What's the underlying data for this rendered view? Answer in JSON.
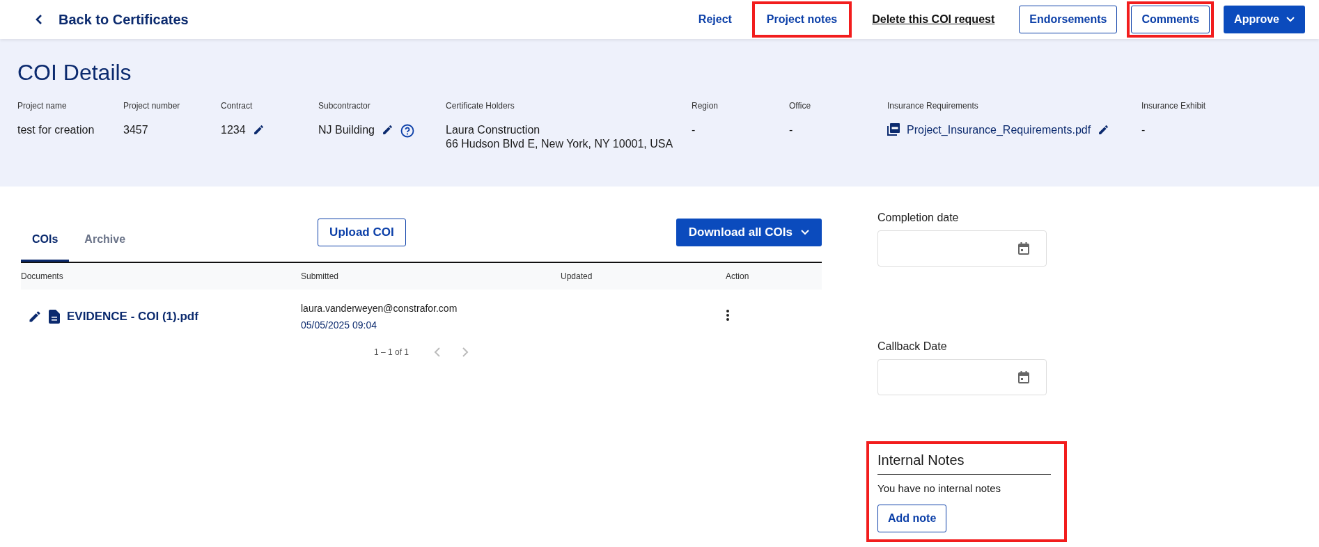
{
  "header": {
    "back_link": "Back to Certificates",
    "actions": [
      {
        "kind": "link",
        "label": "Reject",
        "highlighted": false
      },
      {
        "kind": "link",
        "label": "Project notes",
        "highlighted": true
      },
      {
        "kind": "underlined-link",
        "label": "Delete this COI request",
        "highlighted": false
      },
      {
        "kind": "outline-button",
        "label": "Endorsements",
        "highlighted": false
      },
      {
        "kind": "outline-button",
        "label": "Comments",
        "highlighted": true
      },
      {
        "kind": "primary-menu",
        "label": "Approve",
        "highlighted": false
      }
    ]
  },
  "details": {
    "title": "COI Details",
    "fields": [
      {
        "kind": "text",
        "label": "Project name",
        "lines": [
          "test for creation"
        ],
        "editable": false,
        "help": false
      },
      {
        "kind": "text",
        "label": "Project number",
        "lines": [
          "3457"
        ],
        "editable": false,
        "help": false
      },
      {
        "kind": "text",
        "label": "Contract",
        "lines": [
          "1234"
        ],
        "editable": true,
        "help": false
      },
      {
        "kind": "text",
        "label": "Subcontractor",
        "lines": [
          "NJ Building"
        ],
        "editable": true,
        "help": true
      },
      {
        "kind": "text",
        "label": "Certificate Holders",
        "lines": [
          "Laura Construction",
          "66 Hudson Blvd E, New York, NY 10001, USA"
        ],
        "editable": false,
        "help": false
      },
      {
        "kind": "text",
        "label": "Region",
        "lines": [
          "-"
        ],
        "editable": false,
        "help": false
      },
      {
        "kind": "text",
        "label": "Office",
        "lines": [
          "-"
        ],
        "editable": false,
        "help": false
      },
      {
        "kind": "file",
        "label": "Insurance Requirements",
        "lines": [
          "Project_Insurance_Requirements.pdf"
        ],
        "editable": true,
        "help": false
      },
      {
        "kind": "text",
        "label": "Insurance Exhibit",
        "lines": [
          "-"
        ],
        "editable": false,
        "help": false
      }
    ]
  },
  "tabs": [
    {
      "label": "COIs",
      "selected": true
    },
    {
      "label": "Archive",
      "selected": false
    }
  ],
  "upload_button": "Upload COI",
  "download_button": "Download all COIs",
  "table": {
    "columns": [
      "Documents",
      "Submitted",
      "Updated",
      "Action"
    ],
    "rows": [
      {
        "document": "EVIDENCE - COI (1).pdf",
        "submitted_by": "laura.vanderweyen@constrafor.com",
        "submitted_at": "05/05/2025 09:04"
      }
    ]
  },
  "pagination": "1 – 1 of 1",
  "date_fields": [
    {
      "label": "Completion date"
    },
    {
      "label": "Callback Date"
    }
  ],
  "internal_notes": {
    "title": "Internal Notes",
    "empty_text": "You have no internal notes",
    "add_button": "Add note",
    "highlighted": true
  }
}
